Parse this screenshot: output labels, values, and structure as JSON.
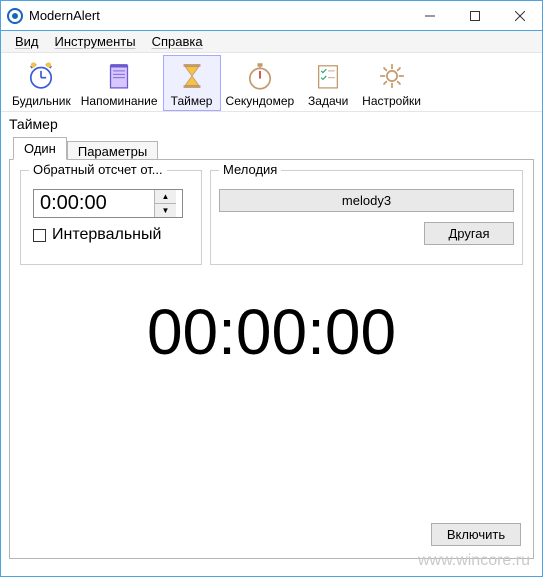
{
  "window": {
    "title": "ModernAlert"
  },
  "menubar": {
    "view": "Вид",
    "tools": "Инструменты",
    "help": "Справка"
  },
  "toolbar": {
    "alarm": "Будильник",
    "reminder": "Напоминание",
    "timer": "Таймер",
    "stopwatch": "Секундомер",
    "tasks": "Задачи",
    "settings": "Настройки",
    "active": "timer"
  },
  "section": {
    "title": "Таймер"
  },
  "tabs": {
    "single": "Один",
    "params": "Параметры",
    "active": "single"
  },
  "countdown_group": {
    "legend": "Обратный отсчет от...",
    "time_value": "0:00:00",
    "interval_label": "Интервальный",
    "interval_checked": false
  },
  "melody_group": {
    "legend": "Мелодия",
    "selected": "melody3",
    "other_button": "Другая"
  },
  "big_time": "00:00:00",
  "start_button": "Включить",
  "watermark": "www.wincore.ru"
}
